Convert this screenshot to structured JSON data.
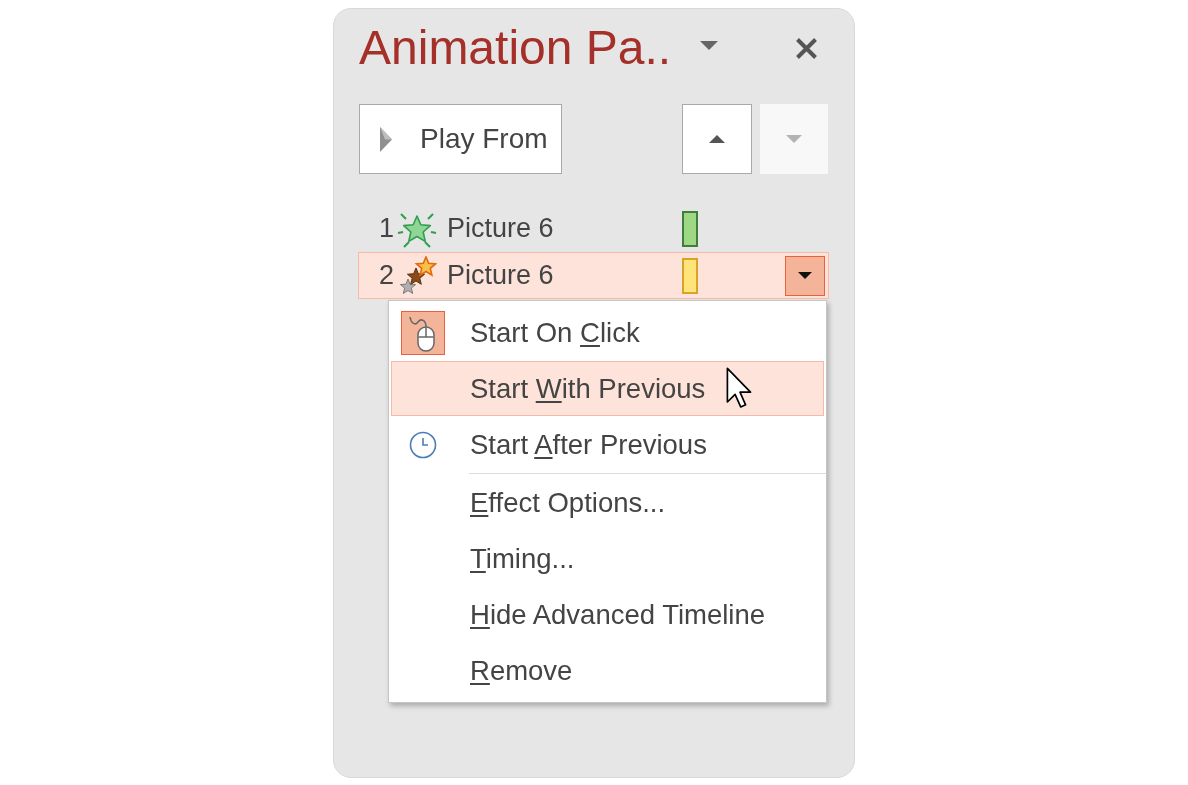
{
  "pane": {
    "title": "Animation Pa..",
    "play_button": {
      "label": "Play From"
    },
    "move_up_button": {
      "disabled": false
    },
    "move_down_button": {
      "disabled": true
    },
    "animations": [
      {
        "number": "1",
        "name": "Picture 6",
        "kind": "entrance",
        "selected": false
      },
      {
        "number": "2",
        "name": "Picture 6",
        "kind": "emphasis",
        "selected": true
      }
    ]
  },
  "context_menu": {
    "start_options": [
      {
        "kind": "onclick",
        "label_start": "Start On ",
        "access_key": "C",
        "label_end": "lick",
        "selected": true,
        "highlighted": false
      },
      {
        "kind": "withprevious",
        "label_start": "Start ",
        "access_key": "W",
        "label_end": "ith Previous",
        "selected": false,
        "highlighted": true
      },
      {
        "kind": "afterprevious",
        "label_start": "Start ",
        "access_key": "A",
        "label_end": "fter Previous",
        "selected": false,
        "highlighted": false
      }
    ],
    "commands": [
      {
        "access_key": "E",
        "label_end": "ffect Options...",
        "highlighted": false
      },
      {
        "access_key": "T",
        "label_end": "iming...",
        "highlighted": false
      },
      {
        "access_key": "H",
        "label_end": "ide Advanced Timeline",
        "highlighted": false
      },
      {
        "access_key": "R",
        "label_end": "emove",
        "highlighted": false
      }
    ]
  }
}
